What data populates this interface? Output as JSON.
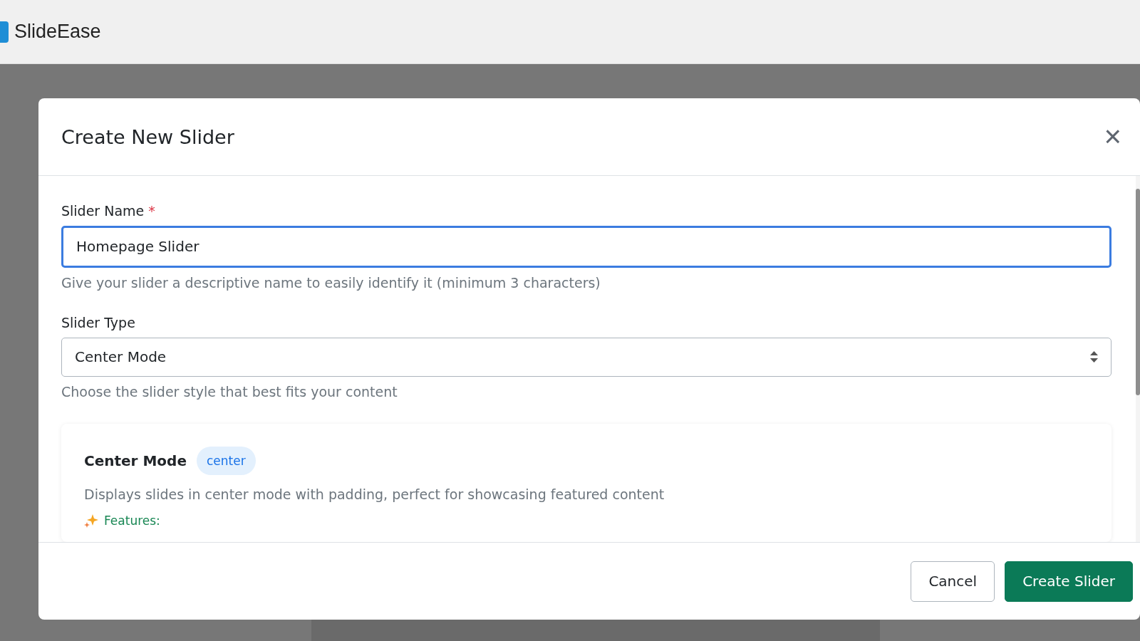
{
  "header": {
    "logo": "SlideEase"
  },
  "dialog": {
    "title": "Create New Slider",
    "close": "×",
    "fields": [
      {
        "kind": "text",
        "label": "Slider Name",
        "required_mark": "*",
        "value": "Homepage Slider",
        "focused": true,
        "help": "Give your slider a descriptive name to easily identify it (minimum 3 characters)"
      },
      {
        "kind": "select",
        "label": "Slider Type",
        "value": "Center Mode",
        "focused": false,
        "help": "Choose the slider style that best fits your content"
      }
    ],
    "preview": {
      "title": "Center Mode",
      "tag": "center",
      "description": "Displays slides in center mode with padding, perfect for showcasing featured content",
      "features_label": "Features:"
    },
    "buttons": [
      {
        "kind": "secondary",
        "label": "Cancel"
      },
      {
        "kind": "primary",
        "label": "Create Slider"
      }
    ]
  }
}
